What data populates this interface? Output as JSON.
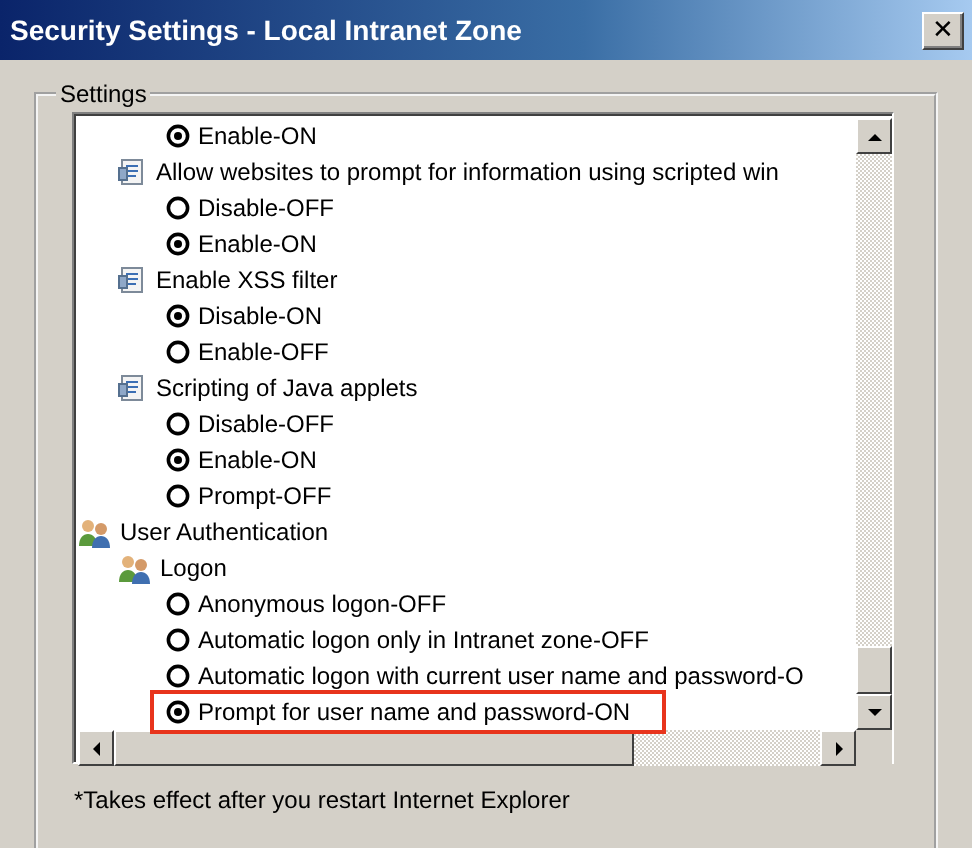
{
  "window": {
    "title": "Security Settings - Local Intranet Zone",
    "close": "✕"
  },
  "group": {
    "label": "Settings"
  },
  "tree": [
    {
      "kind": "category",
      "children": [
        {
          "kind": "setting",
          "children": [
            {
              "kind": "radio",
              "label": "Enable-ON",
              "selected": true,
              "highlighted": false
            }
          ]
        },
        {
          "kind": "setting",
          "label": "Allow websites to prompt for information using scripted win",
          "children": [
            {
              "kind": "radio",
              "label": "Disable-OFF",
              "selected": false,
              "highlighted": false
            },
            {
              "kind": "radio",
              "label": "Enable-ON",
              "selected": true,
              "highlighted": false
            }
          ]
        },
        {
          "kind": "setting",
          "label": "Enable XSS filter",
          "children": [
            {
              "kind": "radio",
              "label": "Disable-ON",
              "selected": true,
              "highlighted": false
            },
            {
              "kind": "radio",
              "label": "Enable-OFF",
              "selected": false,
              "highlighted": false
            }
          ]
        },
        {
          "kind": "setting",
          "label": "Scripting of Java applets",
          "children": [
            {
              "kind": "radio",
              "label": "Disable-OFF",
              "selected": false,
              "highlighted": false
            },
            {
              "kind": "radio",
              "label": "Enable-ON",
              "selected": true,
              "highlighted": false
            },
            {
              "kind": "radio",
              "label": "Prompt-OFF",
              "selected": false,
              "highlighted": false
            }
          ]
        }
      ]
    },
    {
      "kind": "group",
      "label": "User Authentication",
      "children": [
        {
          "kind": "group",
          "label": "Logon",
          "children": [
            {
              "kind": "radio",
              "label": "Anonymous logon-OFF",
              "selected": false,
              "highlighted": false
            },
            {
              "kind": "radio",
              "label": "Automatic logon only in Intranet zone-OFF",
              "selected": false,
              "highlighted": false
            },
            {
              "kind": "radio",
              "label": "Automatic logon with current user name and password-O",
              "selected": false,
              "highlighted": false
            },
            {
              "kind": "radio",
              "label": "Prompt for user name and password-ON",
              "selected": true,
              "highlighted": true
            }
          ]
        }
      ]
    }
  ],
  "note": "*Takes effect after you restart Internet Explorer"
}
